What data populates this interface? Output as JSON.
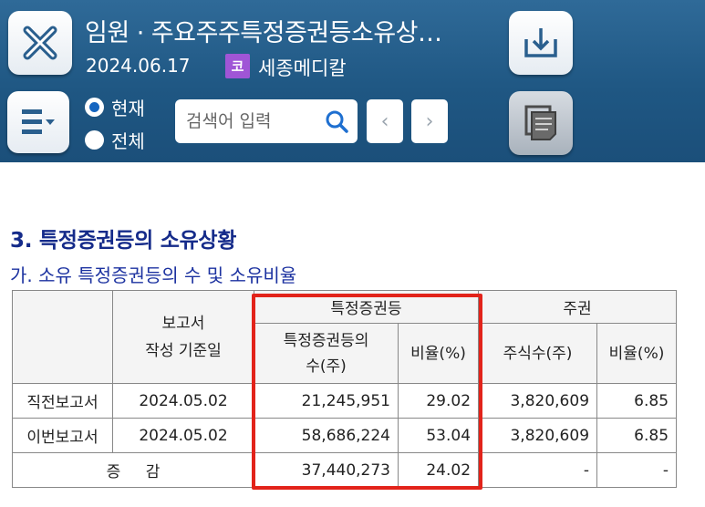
{
  "header": {
    "title": "임원 · 주요주주특정증권등소유상…",
    "date": "2024.06.17",
    "market_badge": "코",
    "company": "세종메디칼",
    "market_badge_color": "#a055d6",
    "bg_color": "#1f5783"
  },
  "scope": {
    "options": [
      {
        "label": "현재",
        "selected": true
      },
      {
        "label": "전체",
        "selected": false
      }
    ]
  },
  "search": {
    "placeholder": "검색어 입력",
    "value": ""
  },
  "nav": {
    "prev": "‹",
    "next": "›"
  },
  "icons": {
    "close": "close-x-icon",
    "menu": "menu-dropdown-icon",
    "download": "download-tray-icon",
    "copy": "copy-document-icon",
    "search": "search-icon"
  },
  "section": {
    "title": "3. 특정증권등의 소유상황",
    "subtitle": "가. 소유 특정증권등의 수 및 소유비율"
  },
  "table": {
    "head": {
      "report_date": "보고서\n작성 기준일",
      "group_securities": "특정증권등",
      "group_shares": "주권",
      "securities_count": "특정증권등의\n수(주)",
      "securities_ratio": "비율(%)",
      "shares_count": "주식수(주)",
      "shares_ratio": "비율(%)"
    },
    "rows": [
      {
        "label": "직전보고서",
        "date": "2024.05.02",
        "sec_count": "21,245,951",
        "sec_ratio": "29.02",
        "share_count": "3,820,609",
        "share_ratio": "6.85"
      },
      {
        "label": "이번보고서",
        "date": "2024.05.02",
        "sec_count": "58,686,224",
        "sec_ratio": "53.04",
        "share_count": "3,820,609",
        "share_ratio": "6.85"
      }
    ],
    "total": {
      "label": "증 감",
      "sec_count": "37,440,273",
      "sec_ratio": "24.02",
      "share_count": "-",
      "share_ratio": "-"
    },
    "highlight_color": "#e2231a"
  }
}
